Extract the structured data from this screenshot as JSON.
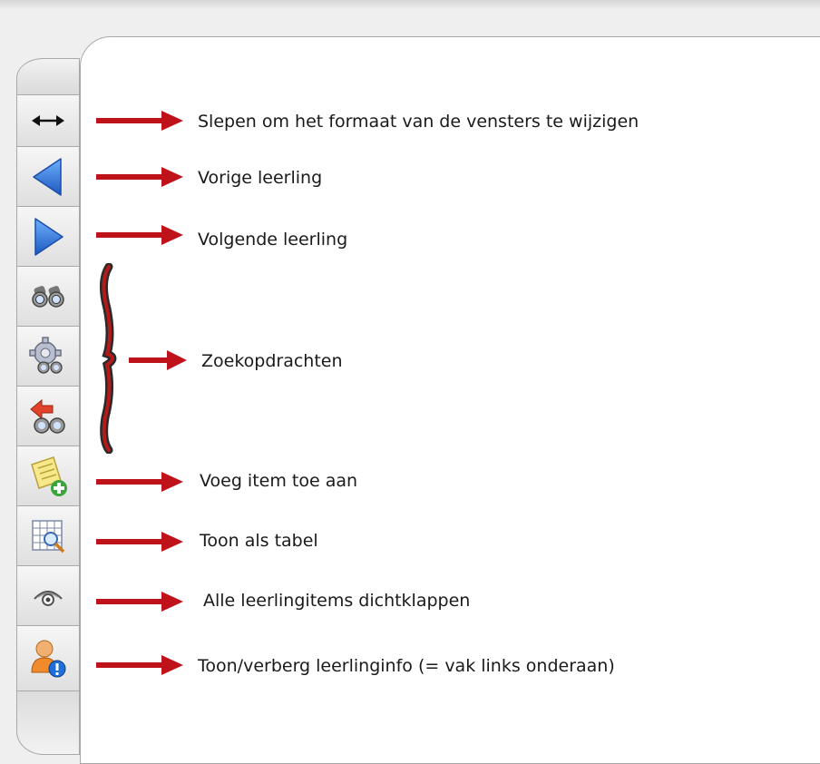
{
  "toolbar": {
    "buttons": [
      {
        "id": "resize",
        "icon": "resize-arrows-icon",
        "label": "Slepen om het formaat van de vensters te wijzigen"
      },
      {
        "id": "prev",
        "icon": "triangle-left-icon",
        "label": "Vorige leerling"
      },
      {
        "id": "next",
        "icon": "triangle-right-icon",
        "label": "Volgende leerling"
      },
      {
        "id": "search",
        "icon": "binoculars-icon",
        "label": ""
      },
      {
        "id": "search-settings",
        "icon": "gear-binoculars-icon",
        "label": ""
      },
      {
        "id": "search-back",
        "icon": "arrow-binoculars-icon",
        "label": ""
      },
      {
        "id": "add-item",
        "icon": "note-add-icon",
        "label": "Voeg item toe aan"
      },
      {
        "id": "table-view",
        "icon": "table-magnifier-icon",
        "label": "Toon als tabel"
      },
      {
        "id": "collapse-all",
        "icon": "eye-icon",
        "label": "Alle leerlingitems dichtklappen"
      },
      {
        "id": "student-info",
        "icon": "user-info-icon",
        "label": "Toon/verberg leerlinginfo (= vak links onderaan)"
      }
    ]
  },
  "annotations": {
    "resize": "Slepen om het formaat van de vensters te wijzigen",
    "previous": "Vorige leerling",
    "next": "Volgende leerling",
    "searches": "Zoekopdrachten",
    "add_item": "Voeg item toe aan",
    "table": "Toon als tabel",
    "collapse": "Alle leerlingitems dichtklappen",
    "info": "Toon/verberg leerlinginfo (= vak links onderaan)"
  },
  "colors": {
    "arrow": "#c0121a",
    "nav_blue": "#2a6fd0",
    "panel_border": "#a8a8a8"
  }
}
